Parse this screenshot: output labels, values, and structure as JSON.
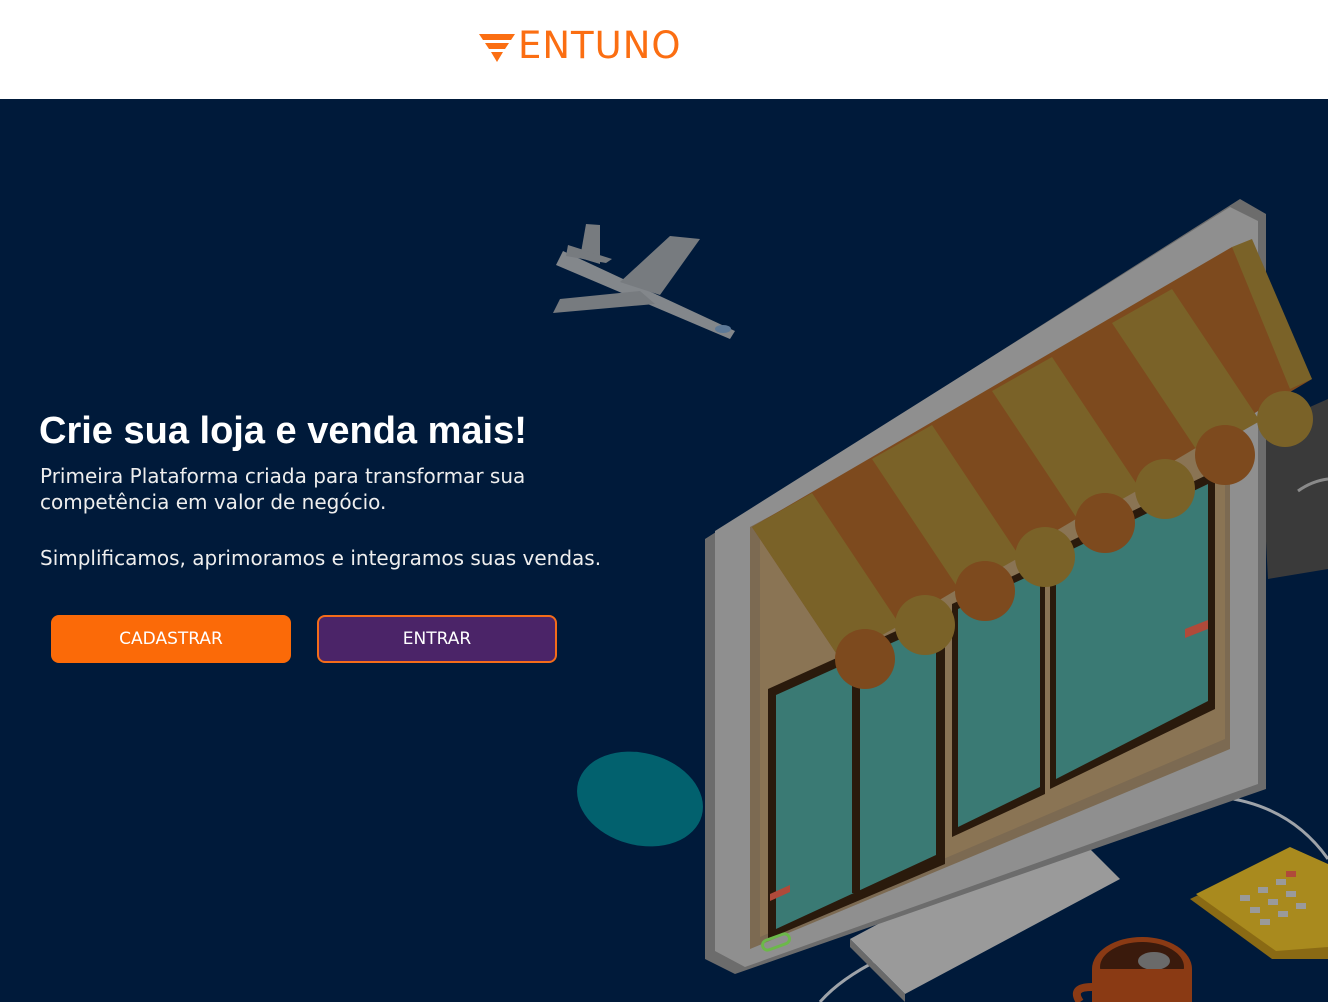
{
  "header": {
    "logo_text": "ENTUNO",
    "brand_color": "#fb6e12"
  },
  "hero": {
    "title": "Crie sua loja e venda mais!",
    "subtitle": "Primeira Plataforma criada para transformar sua competência em valor de negócio.",
    "tagline": "Simplificamos, aprimoramos e integramos suas vendas.",
    "background_color": "#001a3a",
    "primary_button_label": "CADASTRAR",
    "primary_button_color": "#fb6a08",
    "secondary_button_label": "ENTRAR",
    "secondary_button_color": "#4b2468"
  },
  "illustration": {
    "icons": [
      "airplane-icon",
      "storefront-monitor-icon",
      "calculator-icon",
      "coffee-cup-icon"
    ]
  }
}
